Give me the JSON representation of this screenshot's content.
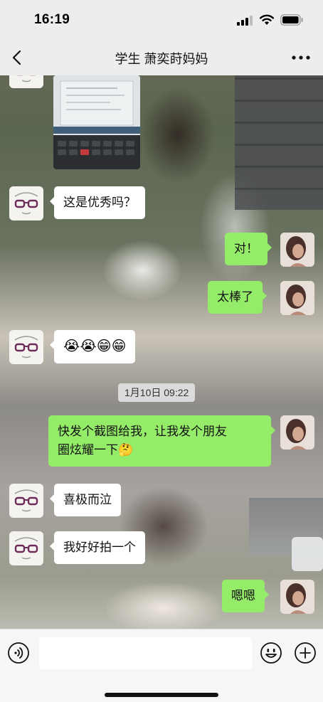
{
  "status_bar": {
    "time": "16:19",
    "signal_icon": "cellular-signal-icon",
    "wifi_icon": "wifi-icon",
    "battery_icon": "battery-icon"
  },
  "nav": {
    "title": "学生 萧奕莳妈妈",
    "back_icon": "chevron-left-icon",
    "more_icon": "more-dots-icon"
  },
  "messages": [
    {
      "from": "teacher",
      "type": "image"
    },
    {
      "from": "teacher",
      "type": "text",
      "text": "这是优秀吗？"
    },
    {
      "from": "me",
      "type": "text",
      "text": "对！"
    },
    {
      "from": "me",
      "type": "text",
      "text": "太棒了"
    },
    {
      "from": "teacher",
      "type": "emoji",
      "text": "😭😭😁😁"
    },
    {
      "type": "timestamp",
      "text": "1月10日 09:22"
    },
    {
      "from": "me",
      "type": "text",
      "line1": "快发个截图给我，让我发个朋友",
      "line2": "圈炫耀一下🤔"
    },
    {
      "from": "teacher",
      "type": "text",
      "text": "喜极而泣"
    },
    {
      "from": "teacher",
      "type": "text",
      "text": "我好好拍一个"
    },
    {
      "from": "me",
      "type": "text",
      "text": "嗯嗯"
    }
  ],
  "input_bar": {
    "voice_icon": "voice-icon",
    "input_value": "",
    "emoji_icon": "emoji-icon",
    "plus_icon": "plus-icon"
  },
  "colors": {
    "bar_background": "#ededed",
    "my_bubble": "#95ec69",
    "their_bubble": "#ffffff"
  }
}
